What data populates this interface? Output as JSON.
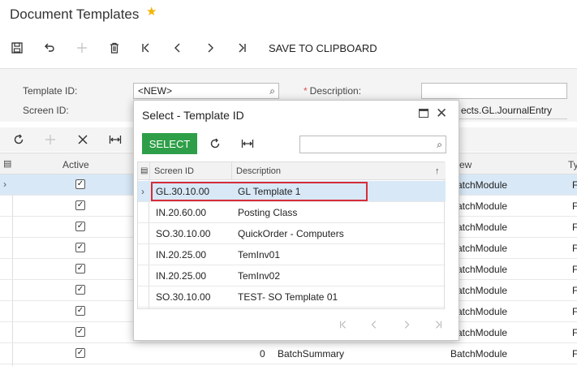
{
  "header": {
    "title": "Document Templates",
    "favorite_icon": "star-icon"
  },
  "toolbar": {
    "clipboard_label": "SAVE TO CLIPBOARD",
    "icons": [
      "save-icon",
      "undo-icon",
      "add-icon",
      "delete-icon",
      "first-icon",
      "prev-icon",
      "next-icon",
      "last-icon"
    ]
  },
  "form": {
    "template_id_label": "Template ID:",
    "template_id_value": "<NEW>",
    "screen_id_label": "Screen ID:",
    "description_label": "Description:",
    "description_value": "",
    "screen_value": "ects.GL.JournalEntry"
  },
  "grid": {
    "columns": {
      "active": "Active",
      "view": "ew",
      "type": "Ty"
    },
    "rows": [
      {
        "active": true,
        "view": "BatchModule",
        "type": "F",
        "selected": true
      },
      {
        "active": true,
        "view": "BatchModule",
        "type": "F"
      },
      {
        "active": true,
        "view": "BatchModule",
        "type": "F"
      },
      {
        "active": true,
        "view": "BatchModule",
        "type": "F"
      },
      {
        "active": true,
        "view": "BatchModule",
        "type": "F"
      },
      {
        "active": true,
        "view": "BatchModule",
        "type": "F"
      },
      {
        "active": true,
        "view": "BatchModule",
        "type": "F"
      },
      {
        "active": true,
        "view": "BatchModule",
        "type": "F"
      },
      {
        "active": true,
        "num": "0",
        "field": "BatchSummary",
        "view": "BatchModule",
        "type": "F"
      }
    ]
  },
  "dialog": {
    "title": "Select - Template ID",
    "select_label": "SELECT",
    "search_value": "",
    "columns": {
      "screen_id": "Screen ID",
      "description": "Description",
      "sort_icon": "↑"
    },
    "rows": [
      {
        "screen_id": "GL.30.10.00",
        "description": "GL Template 1",
        "selected": true
      },
      {
        "screen_id": "IN.20.60.00",
        "description": "Posting Class"
      },
      {
        "screen_id": "SO.30.10.00",
        "description": "QuickOrder - Computers"
      },
      {
        "screen_id": "IN.20.25.00",
        "description": "TemInv01"
      },
      {
        "screen_id": "IN.20.25.00",
        "description": "TemInv02"
      },
      {
        "screen_id": "SO.30.10.00",
        "description": "TEST- SO Template 01"
      }
    ]
  }
}
